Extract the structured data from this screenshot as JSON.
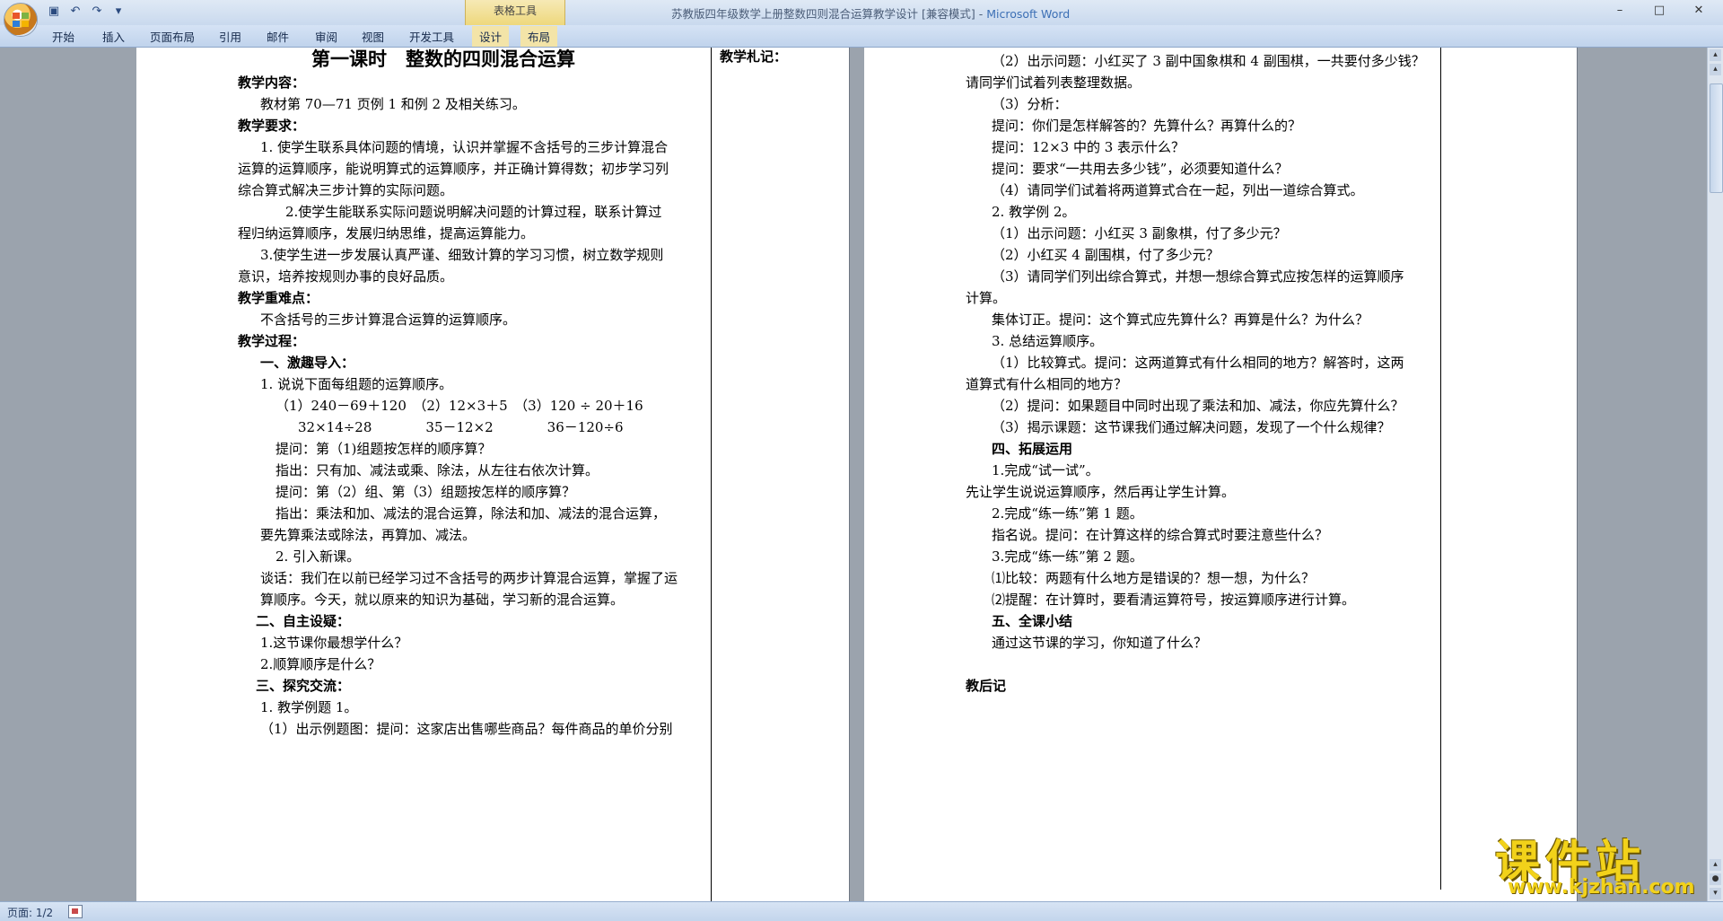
{
  "window": {
    "title_doc": "苏教版四年级数学上册整数四则混合运算教学设计 [兼容模式]",
    "title_sep": " - ",
    "title_app": "Microsoft Word",
    "context_group": "表格工具",
    "controls": [
      "–",
      "□",
      "✕"
    ]
  },
  "ribbon": {
    "tabs": [
      "开始",
      "插入",
      "页面布局",
      "引用",
      "邮件",
      "审阅",
      "视图",
      "开发工具"
    ],
    "context_tabs": [
      "设计",
      "布局"
    ]
  },
  "page1": {
    "title": "第一课时　整数的四则混合运算",
    "side_label": "教学札记：",
    "lines": [
      "教学内容：",
      "教材第 70—71 页例 1 和例 2 及相关练习。",
      "教学要求：",
      "1. 使学生联系具体问题的情境，认识并掌握不含括号的三步计算混合",
      "运算的运算顺序，能说明算式的运算顺序，并正确计算得数；初步学习列",
      "综合算式解决三步计算的实际问题。",
      "2.使学生能联系实际问题说明解决问题的计算过程，联系计算过",
      "程归纳运算顺序，发展归纳思维，提高运算能力。",
      "3.使学生进一步发展认真严谨、细致计算的学习习惯，树立数学规则",
      "意识，培养按规则办事的良好品质。",
      "教学重难点：",
      "不含括号的三步计算混合运算的运算顺序。",
      "教学过程：",
      "一、激趣导入：",
      "1. 说说下面每组题的运算顺序。",
      "（1）240－69＋120　（2）12×3＋5　（3）120 ÷ 20＋16",
      "32×14÷28　　　　35－12×2　　　　36－120÷6",
      "提问：第（1)组题按怎样的顺序算？",
      "指出：只有加、减法或乘、除法，从左往右依次计算。",
      "提问：第（2）组、第（3）组题按怎样的顺序算？",
      "指出：乘法和加、减法的混合运算，除法和加、减法的混合运算，",
      "要先算乘法或除法，再算加、减法。",
      "2. 引入新课。",
      "谈话：我们在以前已经学习过不含括号的两步计算混合运算，掌握了运",
      "算顺序。今天，就以原来的知识为基础，学习新的混合运算。",
      "二、自主设疑：",
      "1.这节课你最想学什么？",
      "2.顺算顺序是什么？",
      "三、探究交流：",
      "1. 教学例题 1。",
      "（1）出示例题图：提问：这家店出售哪些商品？每件商品的单价分别"
    ]
  },
  "page2": {
    "lines": [
      "（2）出示问题：小红买了 3 副中国象棋和 4 副围棋，一共要付多少钱？",
      "请同学们试着列表整理数据。",
      "（3）分析：",
      "提问：你们是怎样解答的？先算什么？再算什么的？",
      "提问：12×3 中的 3 表示什么？",
      "提问：要求“一共用去多少钱”，必须要知道什么？",
      "（4）请同学们试着将两道算式合在一起，列出一道综合算式。",
      "2. 教学例 2。",
      "（1）出示问题：小红买 3 副象棋，付了多少元？",
      "（2）小红买 4 副围棋，付了多少元？",
      "（3）请同学们列出综合算式，并想一想综合算式应按怎样的运算顺序",
      "计算。",
      "集体订正。提问：这个算式应先算什么？再算是什么？为什么？",
      "3. 总结运算顺序。",
      "（1）比较算式。提问：这两道算式有什么相同的地方？解答时，这两",
      "道算式有什么相同的地方？",
      "（2）提问：如果题目中同时出现了乘法和加、减法，你应先算什么？",
      "（3）揭示课题：这节课我们通过解决问题，发现了一个什么规律？",
      "四、拓展运用",
      "1.完成“试一试”。",
      "先让学生说说运算顺序，然后再让学生计算。",
      "2.完成“练一练”第 1 题。",
      "指名说。提问：在计算这样的综合算式时要注意些什么？",
      "3.完成“练一练”第 2 题。",
      "⑴比较：两题有什么地方是错误的？想一想，为什么？",
      "⑵提醒：在计算时，要看清运算符号，按运算顺序进行计算。",
      "五、全课小结",
      "通过这节课的学习，你知道了什么？",
      "",
      "教后记",
      "",
      ""
    ]
  },
  "status": {
    "page": "页面: 1/2"
  },
  "watermark": {
    "name": "课件站",
    "url": "www.kjzhan.com"
  },
  "colors": {
    "ribbon": "#c9d9ee",
    "context_tab": "#eed87c",
    "doc_bg": "#9ba3ad",
    "watermark": "#f2d21a"
  }
}
